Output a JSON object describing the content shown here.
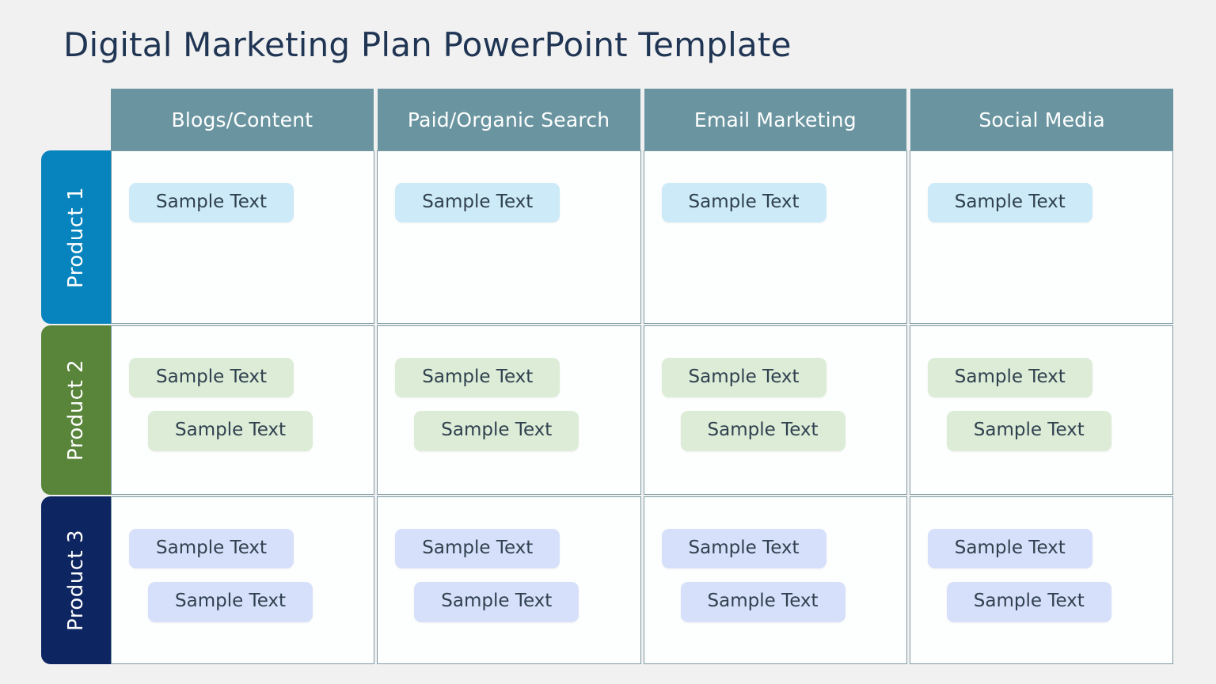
{
  "slide": {
    "title": "Digital Marketing Plan PowerPoint Template",
    "background_color": "#f1f1f1",
    "title_color": "#1f3553"
  },
  "matrix": {
    "header_background": "#6a95a0",
    "header_text_color": "#ffffff",
    "columns": [
      {
        "label": "Blogs/Content"
      },
      {
        "label": "Paid/Organic Search"
      },
      {
        "label": "Email Marketing"
      },
      {
        "label": "Social Media"
      }
    ],
    "rows": [
      {
        "label": "Product 1",
        "tab_color": "#0783bd",
        "pill_color": "#cdeaf8",
        "cells": [
          {
            "items": [
              "Sample Text"
            ]
          },
          {
            "items": [
              "Sample Text"
            ]
          },
          {
            "items": [
              "Sample Text"
            ]
          },
          {
            "items": [
              "Sample Text"
            ]
          }
        ]
      },
      {
        "label": "Product 2",
        "tab_color": "#588539",
        "pill_color": "#dcecd7",
        "cells": [
          {
            "items": [
              "Sample Text",
              "Sample Text"
            ]
          },
          {
            "items": [
              "Sample Text",
              "Sample Text"
            ]
          },
          {
            "items": [
              "Sample Text",
              "Sample Text"
            ]
          },
          {
            "items": [
              "Sample Text",
              "Sample Text"
            ]
          }
        ]
      },
      {
        "label": "Product 3",
        "tab_color": "#0d2560",
        "pill_color": "#d7e0fa",
        "cells": [
          {
            "items": [
              "Sample Text",
              "Sample Text"
            ]
          },
          {
            "items": [
              "Sample Text",
              "Sample Text"
            ]
          },
          {
            "items": [
              "Sample Text",
              "Sample Text"
            ]
          },
          {
            "items": [
              "Sample Text",
              "Sample Text"
            ]
          }
        ]
      }
    ]
  }
}
